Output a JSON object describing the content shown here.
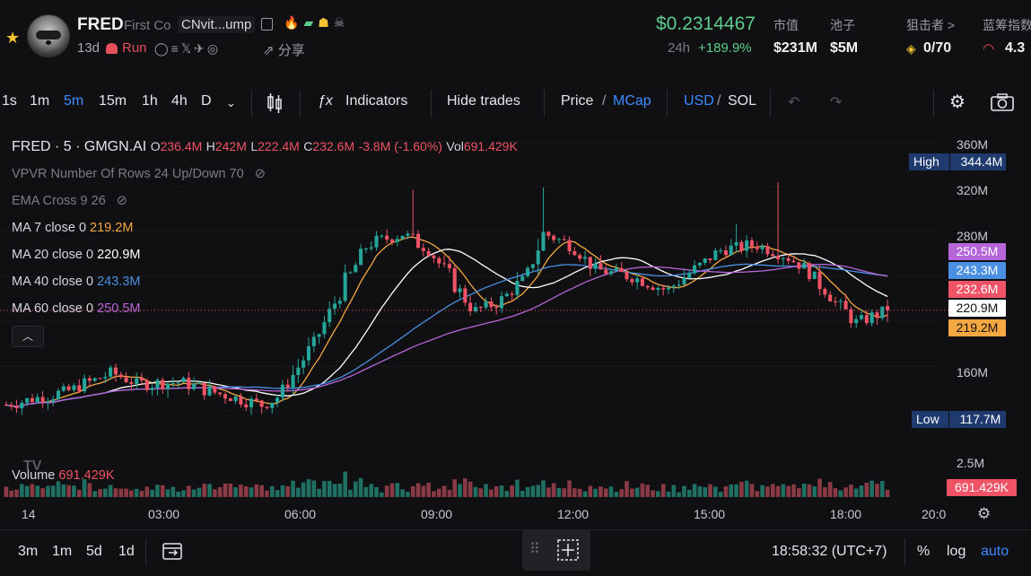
{
  "header": {
    "token_symbol": "FRED",
    "token_name": "First Co",
    "address": "CNvit...ump",
    "age": "13d",
    "status": "Run",
    "share_label": "分享",
    "price": "$0.2314467",
    "change_period": "24h",
    "change_value": "+189.9%",
    "stats": [
      {
        "label": "市值",
        "value": "$231M"
      },
      {
        "label": "池子",
        "value": "$5M"
      },
      {
        "label": "狙击者 >",
        "value": "0/70"
      },
      {
        "label": "蓝筹指数",
        "value": "4.3"
      }
    ]
  },
  "toolbar": {
    "intervals": [
      "1s",
      "1m",
      "5m",
      "15m",
      "1h",
      "4h",
      "D"
    ],
    "active_interval": "5m",
    "indicators_label": "Indicators",
    "hide_trades_label": "Hide trades",
    "price_label": "Price",
    "mcap_label": "MCap",
    "usd_label": "USD",
    "sol_label": "SOL"
  },
  "legend": {
    "title": "FRED · 5 · GMGN.AI",
    "o_label": "O",
    "o_value": "236.4M",
    "h_label": "H",
    "h_value": "242M",
    "l_label": "L",
    "l_value": "222.4M",
    "c_label": "C",
    "c_value": "232.6M",
    "change": "-3.8M (-1.60%)",
    "vol_label": "Vol",
    "vol_value": "691.429K",
    "vpvr": "VPVR Number Of Rows 24 Up/Down 70",
    "ema": "EMA Cross 9 26",
    "ma7_label": "MA 7 close 0",
    "ma7_value": "219.2M",
    "ma20_label": "MA 20 close 0",
    "ma20_value": "220.9M",
    "ma40_label": "MA 40 close 0",
    "ma40_value": "243.3M",
    "ma60_label": "MA 60 close 0",
    "ma60_value": "250.5M",
    "volume_label": "Volume",
    "volume_value": "691.429K"
  },
  "price_axis": {
    "ticks": [
      "360M",
      "320M",
      "280M",
      "160M",
      "2.5M"
    ],
    "high_label": "High",
    "high_value": "344.4M",
    "low_label": "Low",
    "low_value": "117.7M",
    "badges": [
      "250.5M",
      "243.3M",
      "232.6M",
      "220.9M",
      "219.2M",
      "691.429K"
    ]
  },
  "time_axis": {
    "ticks": [
      "14",
      "03:00",
      "06:00",
      "09:00",
      "12:00",
      "15:00",
      "18:00",
      "20:0"
    ]
  },
  "bottom_bar": {
    "ranges": [
      "3m",
      "1m",
      "5d",
      "1d"
    ],
    "clock": "18:58:32 (UTC+7)",
    "percent": "%",
    "log": "log",
    "auto": "auto"
  },
  "colors": {
    "up": "#26a69a",
    "down": "#f05365",
    "ma7": "#f5a742",
    "ma20": "#ffffff",
    "ma40": "#4a90e2",
    "ma60": "#b565d8",
    "accent": "#3d8bff",
    "price_green": "#5ccd8c"
  },
  "chart_data": {
    "type": "candlestick",
    "y_range": [
      100,
      380
    ],
    "candles_count": 170,
    "last": {
      "open": 236.4,
      "high": 242,
      "low": 222.4,
      "close": 232.6,
      "volume": "691.429K"
    },
    "high": 344.4,
    "low": 117.7,
    "ma_last": {
      "ma7": 219.2,
      "ma20": 220.9,
      "ma40": 243.3,
      "ma60": 250.5
    }
  }
}
